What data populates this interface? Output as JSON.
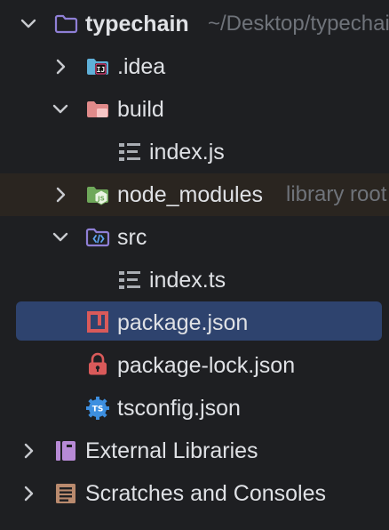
{
  "project_tree": {
    "root": {
      "label": "typechain",
      "path_hint": "~/Desktop/typechain"
    },
    "items": {
      "idea": {
        "label": ".idea"
      },
      "build": {
        "label": "build"
      },
      "build_index": {
        "label": "index.js"
      },
      "node_modules": {
        "label": "node_modules",
        "hint": "library root"
      },
      "src": {
        "label": "src"
      },
      "src_index": {
        "label": "index.ts"
      },
      "package_json": {
        "label": "package.json"
      },
      "package_lock": {
        "label": "package-lock.json"
      },
      "tsconfig": {
        "label": "tsconfig.json"
      }
    },
    "external_libraries": {
      "label": "External Libraries"
    },
    "scratches": {
      "label": "Scratches and Consoles"
    }
  },
  "colors": {
    "background": "#1e1f22",
    "selection": "#2e436e",
    "library_row": "#2a2520",
    "text": "#dfe1e5",
    "hint_text": "#6f737a",
    "folder_icon": "#8f7fd6",
    "excluded_folder": "#e08a8a",
    "npm_red": "#d95a5a",
    "ts_blue": "#3d8fe0"
  },
  "icons": {
    "expanded": "chevron-down-icon",
    "collapsed": "chevron-right-icon",
    "folder": "folder-icon",
    "idea_folder": "idea-folder-icon",
    "excluded_folder": "excluded-folder-icon",
    "node_folder": "nodejs-folder-icon",
    "source_folder": "source-folder-icon",
    "file": "text-file-icon",
    "npm": "npm-icon",
    "lock": "lock-icon",
    "tsconfig": "tsconfig-icon",
    "libraries": "libraries-icon",
    "scratches": "scratches-icon"
  }
}
